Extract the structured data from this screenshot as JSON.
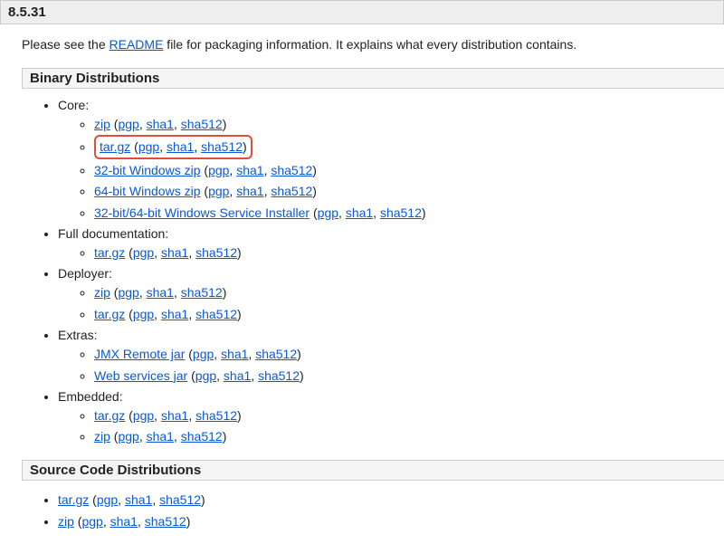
{
  "version_header": "8.5.31",
  "intro_prefix": "Please see the ",
  "intro_link": "README",
  "intro_suffix": " file for packaging information. It explains what every distribution contains.",
  "binary_header": "Binary Distributions",
  "source_header": "Source Code Distributions",
  "lp": "(",
  "rp": ")",
  "comma": ", ",
  "pgp": "pgp",
  "sha1": "sha1",
  "sha512": "sha512",
  "groups": [
    {
      "label": "Core:",
      "items": [
        "zip",
        "tar.gz",
        "32-bit Windows zip",
        "64-bit Windows zip",
        "32-bit/64-bit Windows Service Installer"
      ],
      "highlight_index": 1
    },
    {
      "label": "Full documentation:",
      "items": [
        "tar.gz"
      ]
    },
    {
      "label": "Deployer:",
      "items": [
        "zip",
        "tar.gz"
      ]
    },
    {
      "label": "Extras:",
      "items": [
        "JMX Remote jar",
        "Web services jar"
      ]
    },
    {
      "label": "Embedded:",
      "items": [
        "tar.gz",
        "zip"
      ]
    }
  ],
  "source_items": [
    "tar.gz",
    "zip"
  ]
}
